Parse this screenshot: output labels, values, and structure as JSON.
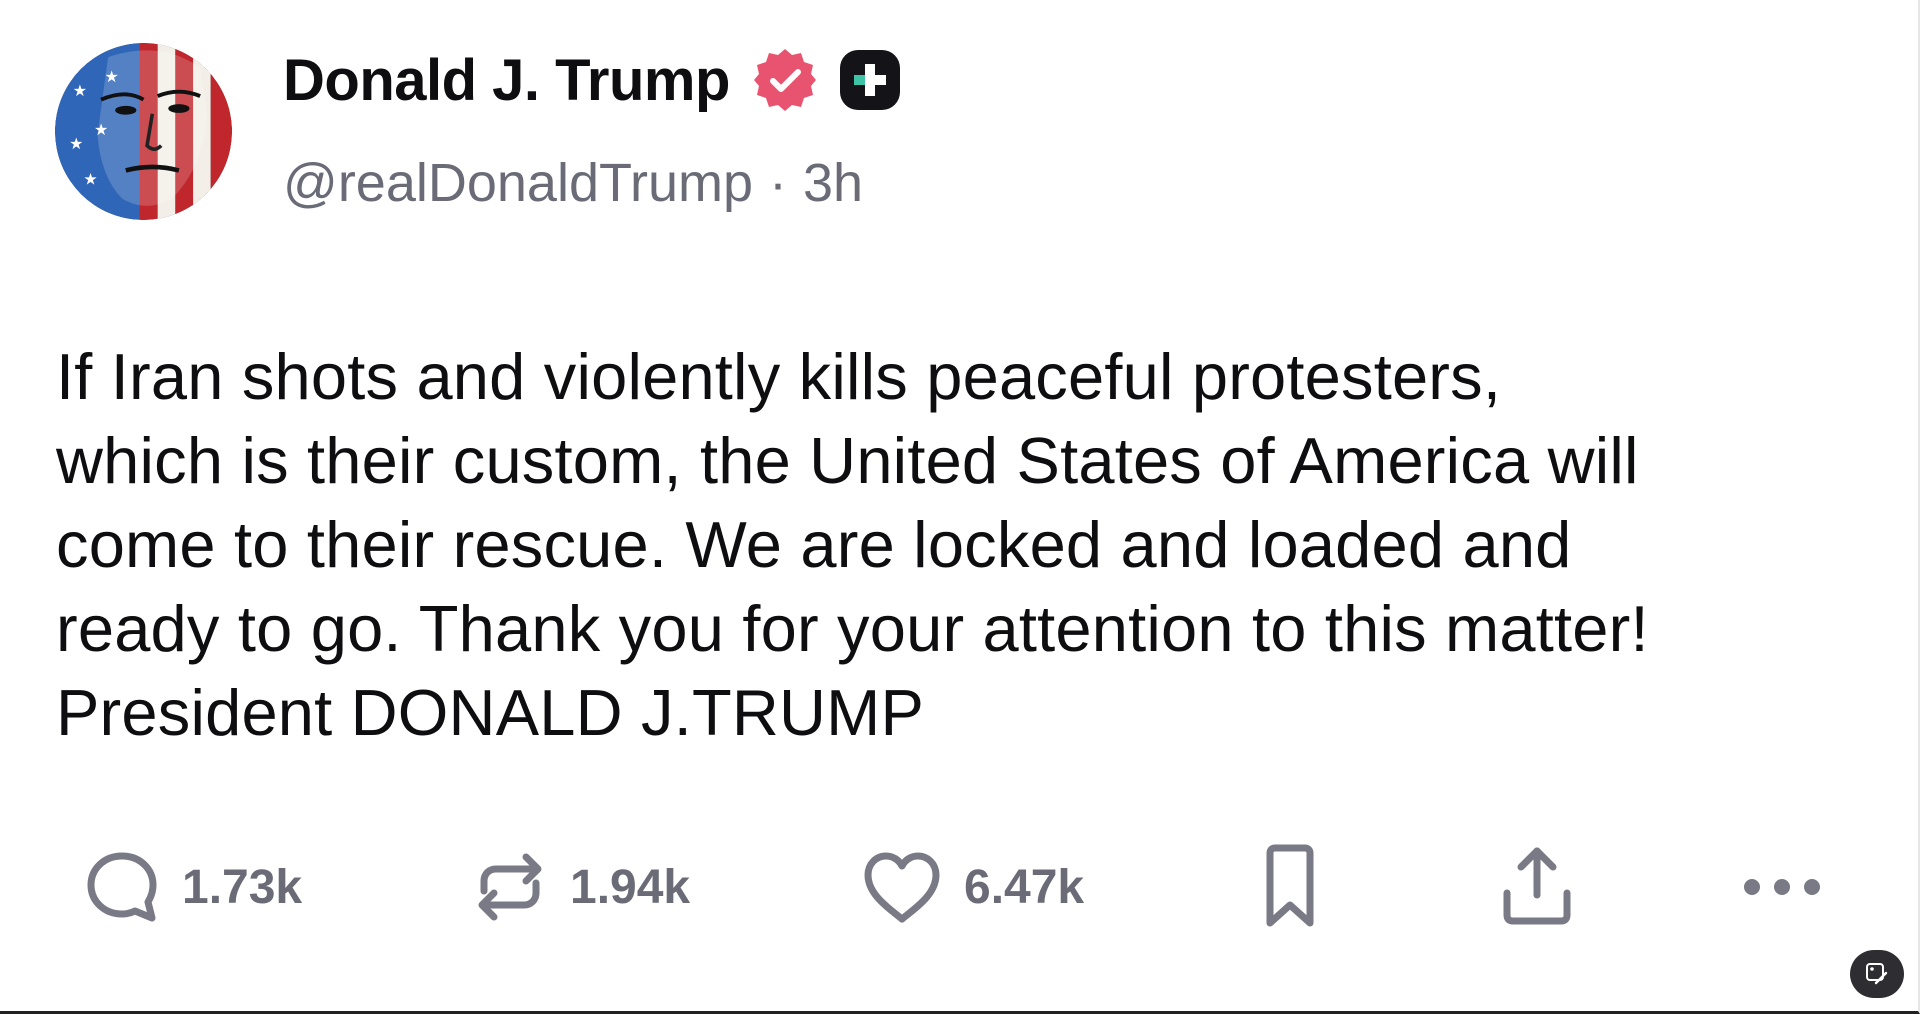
{
  "author": {
    "display_name": "Donald J. Trump",
    "handle": "@realDonaldTrump",
    "separator": "·",
    "timestamp": "3h",
    "avatar_icon": "avatar-american-flag-face",
    "verified_icon": "verified-badge-icon",
    "verified_color": "#e8546f",
    "plus_badge_icon": "plus-badge-icon"
  },
  "post": {
    "text": "If Iran shots and violently kills peaceful protesters,\nwhich is their custom, the United States of America will\ncome to their rescue. We are locked and loaded and\nready to go. Thank you for your attention to this matter!\nPresident DONALD J.TRUMP"
  },
  "actions": {
    "reply": {
      "icon": "reply-icon",
      "count": "1.73k"
    },
    "repost": {
      "icon": "repost-icon",
      "count": "1.94k"
    },
    "like": {
      "icon": "heart-icon",
      "count": "6.47k"
    },
    "bookmark": {
      "icon": "bookmark-icon"
    },
    "share": {
      "icon": "share-icon"
    },
    "more": {
      "icon": "more-icon"
    }
  },
  "colors": {
    "text": "#0e0e10",
    "secondary": "#6b6b78",
    "icon": "#7a7a86"
  }
}
